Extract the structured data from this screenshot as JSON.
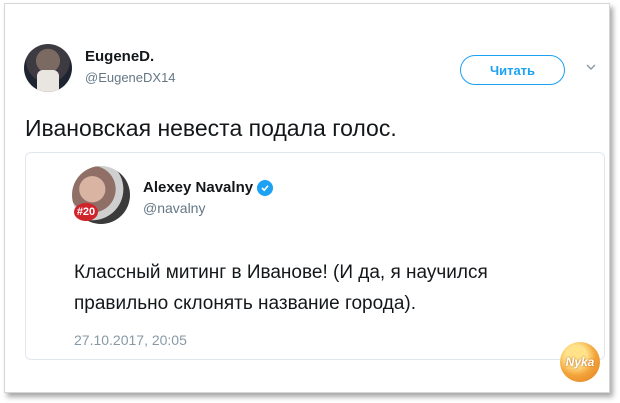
{
  "tweet": {
    "author_name": "EugeneD.",
    "author_handle": "@EugeneDX14",
    "follow_label": "Читать",
    "text": "Ивановская невеста подала голос."
  },
  "quoted_tweet": {
    "author_name": "Alexey Navalny",
    "author_handle": "@navalny",
    "avatar_badge": "#20",
    "text_line1": "Классный митинг в Иванове! (И да, я научился",
    "text_line2": "правильно склонять название города).",
    "date": "27.10.2017, 20:05"
  },
  "watermark": {
    "text": "Nyka"
  },
  "colors": {
    "accent": "#1da1f2",
    "secondary_text": "#657786",
    "badge_red": "#d0242b"
  },
  "icons": {
    "chevron": "chevron-down-icon",
    "verified": "verified-badge-icon"
  }
}
